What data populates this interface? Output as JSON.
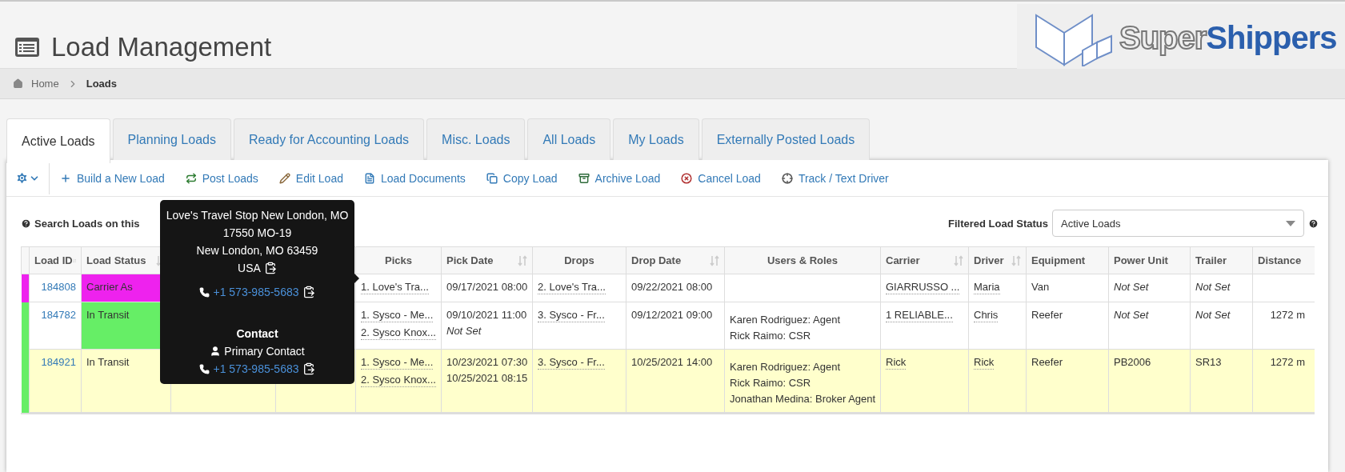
{
  "page": {
    "title": "Load Management"
  },
  "logo": {
    "light_part": "Super",
    "bold_part": "Shippers"
  },
  "breadcrumb": [
    {
      "label": "Home",
      "current": false
    },
    {
      "label": "Loads",
      "current": true
    }
  ],
  "tabs": [
    {
      "label": "Active Loads",
      "selected": true
    },
    {
      "label": "Planning Loads",
      "selected": false
    },
    {
      "label": "Ready for Accounting Loads",
      "selected": false
    },
    {
      "label": "Misc. Loads",
      "selected": false
    },
    {
      "label": "All Loads",
      "selected": false
    },
    {
      "label": "My Loads",
      "selected": false
    },
    {
      "label": "Externally Posted Loads",
      "selected": false
    }
  ],
  "toolbar": [
    {
      "kind": "add",
      "label": "Build a New Load"
    },
    {
      "kind": "post",
      "label": "Post Loads"
    },
    {
      "kind": "edit",
      "label": "Edit Load"
    },
    {
      "kind": "documents",
      "label": "Load Documents"
    },
    {
      "kind": "copy",
      "label": "Copy Load"
    },
    {
      "kind": "archive",
      "label": "Archive Load"
    },
    {
      "kind": "cancel",
      "label": "Cancel Load"
    },
    {
      "kind": "track",
      "label": "Track / Text Driver"
    }
  ],
  "search": {
    "label": "Search Loads on this"
  },
  "filter": {
    "label": "Filtered Load Status",
    "value": "Active Loads"
  },
  "table": {
    "columns": [
      {
        "label": "Load ID",
        "sortable": true
      },
      {
        "label": "Load Status",
        "sortable": true
      },
      {},
      {},
      {
        "label": "Picks",
        "sortable": false
      },
      {
        "label": "Pick Date",
        "sortable": true
      },
      {
        "label": "Drops",
        "sortable": false
      },
      {
        "label": "Drop Date",
        "sortable": true
      },
      {
        "label": "Users & Roles",
        "sortable": false
      },
      {
        "label": "Carrier",
        "sortable": true
      },
      {
        "label": "Driver",
        "sortable": true
      },
      {
        "label": "Equipment",
        "sortable": false
      },
      {
        "label": "Power Unit",
        "sortable": false
      },
      {
        "label": "Trailer",
        "sortable": false
      },
      {
        "label": "Distance",
        "sortable": false
      }
    ],
    "rows": [
      {
        "id": "184808",
        "status": "Carrier As",
        "color": "#ee22ee",
        "status_filled": true,
        "highlighted": false,
        "picks": [
          "1. Love's Tra..."
        ],
        "pick_dates": [
          {
            "text": "09/17/2021 08:00",
            "unset": false
          }
        ],
        "drops": [
          "2. Love's Tra..."
        ],
        "drop_date": "09/22/2021 08:00",
        "users": [],
        "carrier": "GIARRUSSO ...",
        "driver": "Maria",
        "equipment": "Van",
        "power_unit": {
          "text": "Not Set",
          "unset": true
        },
        "trailer": {
          "text": "Not Set",
          "unset": true
        }
      },
      {
        "id": "184782",
        "status": "In Transit",
        "color": "#66ee66",
        "status_filled": true,
        "highlighted": false,
        "picks": [
          "1. Sysco - Me...",
          "2. Sysco Knox..."
        ],
        "pick_dates": [
          {
            "text": "09/10/2021 11:00",
            "unset": false
          },
          {
            "text": "Not Set",
            "unset": true
          }
        ],
        "drops": [
          "3. Sysco - Fr..."
        ],
        "drop_date": "09/12/2021 09:00",
        "users": [
          "Karen Rodriguez: Agent",
          "Rick Raimo: CSR"
        ],
        "carrier": "1 RELIABLE...",
        "driver": "Chris",
        "equipment": "Reefer",
        "power_unit": {
          "text": "Not Set",
          "unset": true
        },
        "trailer": {
          "text": "Not Set",
          "unset": true
        },
        "distance": "1272 m"
      },
      {
        "id": "184921",
        "status": "In Transit",
        "color": "#66ee66",
        "status_filled": false,
        "highlighted": true,
        "picks": [
          "1. Sysco - Me...",
          "2. Sysco Knox..."
        ],
        "pick_dates": [
          {
            "text": "10/23/2021 07:30",
            "unset": false
          },
          {
            "text": "10/25/2021 08:15",
            "unset": false
          }
        ],
        "drops": [
          "3. Sysco - Fr..."
        ],
        "drop_date": "10/25/2021 14:00",
        "users": [
          "Karen Rodriguez: Agent",
          "Rick Raimo: CSR",
          "Jonathan Medina: Broker Agent"
        ],
        "carrier": "Rick",
        "driver": "Rick",
        "equipment": "Reefer",
        "power_unit": {
          "text": "PB2006",
          "unset": false
        },
        "trailer": {
          "text": "SR13",
          "unset": false
        },
        "distance": "1272 m"
      }
    ]
  },
  "tooltip": {
    "address": [
      "Love's Travel Stop New London, MO",
      "17550 MO-19",
      "New London, MO 63459",
      "USA"
    ],
    "phone": "+1 573-985-5683",
    "contact_heading": "Contact",
    "contact_name": "Primary Contact",
    "contact_phone": "+1 573-985-5683"
  }
}
